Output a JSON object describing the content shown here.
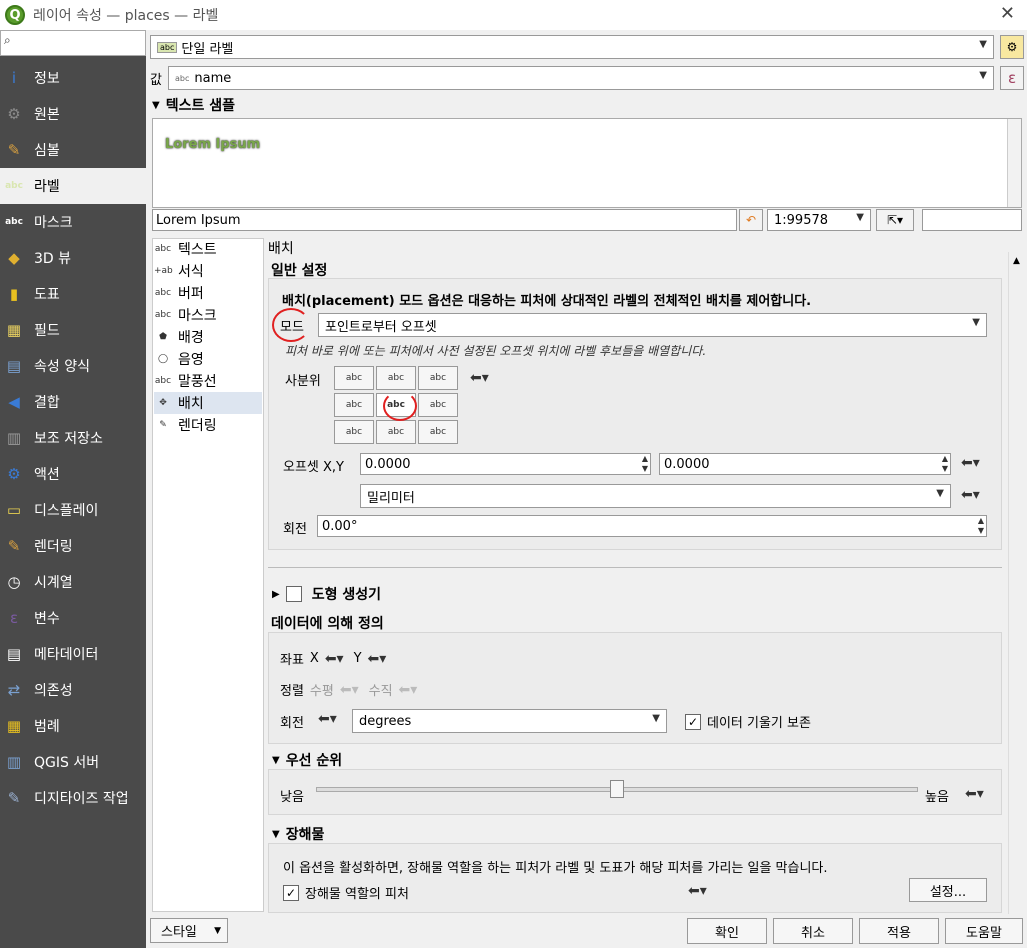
{
  "window": {
    "title": "레이어 속성 — places — 라벨",
    "close_glyph": "✕"
  },
  "sidebar": {
    "search_placeholder": "",
    "items": [
      {
        "label": "정보",
        "icon": "info-icon",
        "color": "#3a7bd5",
        "glyph": "i"
      },
      {
        "label": "원본",
        "icon": "source-icon",
        "color": "#8a8a8a",
        "glyph": "⚙"
      },
      {
        "label": "심볼",
        "icon": "symbology-icon",
        "color": "#d8a040",
        "glyph": "✎"
      },
      {
        "label": "라벨",
        "icon": "labels-icon",
        "color": "#d9e6b0",
        "glyph": "abc"
      },
      {
        "label": "마스크",
        "icon": "mask-icon",
        "color": "#ffffff",
        "glyph": "abc"
      },
      {
        "label": "3D 뷰",
        "icon": "3d-view-icon",
        "color": "#e0b030",
        "glyph": "◆"
      },
      {
        "label": "도표",
        "icon": "diagram-icon",
        "color": "#e8c020",
        "glyph": "▮"
      },
      {
        "label": "필드",
        "icon": "fields-icon",
        "color": "#e8d060",
        "glyph": "▦"
      },
      {
        "label": "속성 양식",
        "icon": "attributes-form-icon",
        "color": "#7aa0d0",
        "glyph": "▤"
      },
      {
        "label": "결합",
        "icon": "joins-icon",
        "color": "#3a7bd5",
        "glyph": "◀"
      },
      {
        "label": "보조 저장소",
        "icon": "auxiliary-storage-icon",
        "color": "#9a9a9a",
        "glyph": "▥"
      },
      {
        "label": "액션",
        "icon": "actions-icon",
        "color": "#3a7bd5",
        "glyph": "⚙"
      },
      {
        "label": "디스플레이",
        "icon": "display-icon",
        "color": "#e8d050",
        "glyph": "▭"
      },
      {
        "label": "렌더링",
        "icon": "rendering-icon",
        "color": "#d8a040",
        "glyph": "✎"
      },
      {
        "label": "시계열",
        "icon": "temporal-icon",
        "color": "#ffffff",
        "glyph": "◷"
      },
      {
        "label": "변수",
        "icon": "variables-icon",
        "color": "#7a5aa0",
        "glyph": "ε"
      },
      {
        "label": "메타데이터",
        "icon": "metadata-icon",
        "color": "#ffffff",
        "glyph": "▤"
      },
      {
        "label": "의존성",
        "icon": "dependencies-icon",
        "color": "#7aa0d0",
        "glyph": "⇄"
      },
      {
        "label": "범례",
        "icon": "legend-icon",
        "color": "#e8c020",
        "glyph": "▦"
      },
      {
        "label": "QGIS 서버",
        "icon": "qgis-server-icon",
        "color": "#7aa0d0",
        "glyph": "▥"
      },
      {
        "label": "디지타이즈 작업",
        "icon": "digitizing-icon",
        "color": "#9ab0d0",
        "glyph": "✎"
      }
    ],
    "selected_index": 3
  },
  "top": {
    "label_mode": "단일 라벨",
    "value_label": "값",
    "value_field": "name",
    "abc_glyph": "abc",
    "epsilon_glyph": "ε"
  },
  "sample": {
    "title": "텍스트 샘플",
    "preview_text": "Lorem Ipsum",
    "input_value": "Lorem Ipsum",
    "scale": "1:99578"
  },
  "nav": {
    "items": [
      {
        "label": "텍스트",
        "icon": "text-icon",
        "glyph": "abc"
      },
      {
        "label": "서식",
        "icon": "formatting-icon",
        "glyph": "+ab"
      },
      {
        "label": "버퍼",
        "icon": "buffer-icon",
        "glyph": "abc"
      },
      {
        "label": "마스크",
        "icon": "mask-icon",
        "glyph": "abc"
      },
      {
        "label": "배경",
        "icon": "background-icon",
        "glyph": "⬟"
      },
      {
        "label": "음영",
        "icon": "shadow-icon",
        "glyph": "◯"
      },
      {
        "label": "말풍선",
        "icon": "callouts-icon",
        "glyph": "abc"
      },
      {
        "label": "배치",
        "icon": "placement-icon",
        "glyph": "✥"
      },
      {
        "label": "렌더링",
        "icon": "rendering-icon",
        "glyph": "✎"
      }
    ],
    "selected_index": 7
  },
  "placement": {
    "header": "배치",
    "general_title": "일반 설정",
    "description": "배치(placement) 모드 옵션은 대응하는 피처에 상대적인 라벨의 전체적인 배치를 제어합니다.",
    "mode_label": "모드",
    "mode_value": "포인트로부터 오프셋",
    "mode_hint": "피처 바로 위에 또는 피처에서 사전 설정된 오프셋 위치에 라벨 후보들을 배열합니다.",
    "quadrant_label": "사분위",
    "quadrant_glyph": "abc",
    "offset_label": "오프셋 X,Y",
    "offset_x": "0.0000",
    "offset_y": "0.0000",
    "unit": "밀리미터",
    "rotation_label": "회전",
    "rotation_value": "0.00°"
  },
  "geometry_generator": {
    "title": "도형 생성기"
  },
  "data_defined": {
    "title": "데이터에 의해 정의",
    "coord_label": "좌표",
    "x_label": "X",
    "y_label": "Y",
    "align_label": "정렬",
    "horizontal_label": "수평",
    "vertical_label": "수직",
    "rotation_label": "회전",
    "rotation_unit": "degrees",
    "preserve_label": "데이터 기울기 보존",
    "preserve_checked": true
  },
  "priority": {
    "title": "우선 순위",
    "low_label": "낮음",
    "high_label": "높음",
    "slider_fraction": 0.5
  },
  "obstacles": {
    "title": "장해물",
    "description": "이 옵션을 활성화하면, 장해물 역할을 하는 피처가 라벨 및 도표가 해당 피처를 가리는 일을 막습니다.",
    "checkbox_label": "장해물 역할의 피처",
    "checked": true,
    "settings_button": "설정..."
  },
  "footer": {
    "style_button": "스타일",
    "ok": "확인",
    "cancel": "취소",
    "apply": "적용",
    "help": "도움말"
  },
  "colors": {
    "sidebar_bg": "#4a4a4a",
    "accent_red": "#e02020",
    "window_bg": "#f0f0f0"
  }
}
